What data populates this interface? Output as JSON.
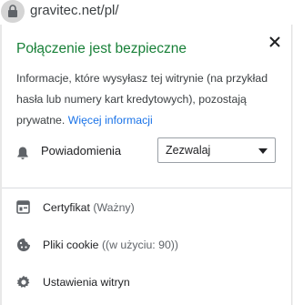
{
  "address_bar": {
    "url": "gravitec.net/pl/",
    "lock_icon": "lock-icon"
  },
  "popup": {
    "title": "Połączenie jest bezpieczne",
    "description": "Informacje, które wysyłasz tej witrynie (na przykład hasła lub numery kart kredytowych), pozostają prywatne.",
    "learn_more": "Więcej informacji",
    "close_icon": "close-icon",
    "notifications": {
      "icon": "bell-icon",
      "label": "Powiadomienia",
      "selected": "Zezwalaj"
    },
    "items": [
      {
        "icon": "certificate-icon",
        "label": "Certyfikat",
        "sub": "(Ważny)"
      },
      {
        "icon": "cookie-icon",
        "label": "Pliki cookie",
        "sub": "((w użyciu: 90))"
      },
      {
        "icon": "gear-icon",
        "label": "Ustawienia witryn",
        "sub": ""
      }
    ]
  },
  "colors": {
    "title_green": "#188038",
    "link_blue": "#1a73e8",
    "icon_grey": "#5f6368"
  }
}
